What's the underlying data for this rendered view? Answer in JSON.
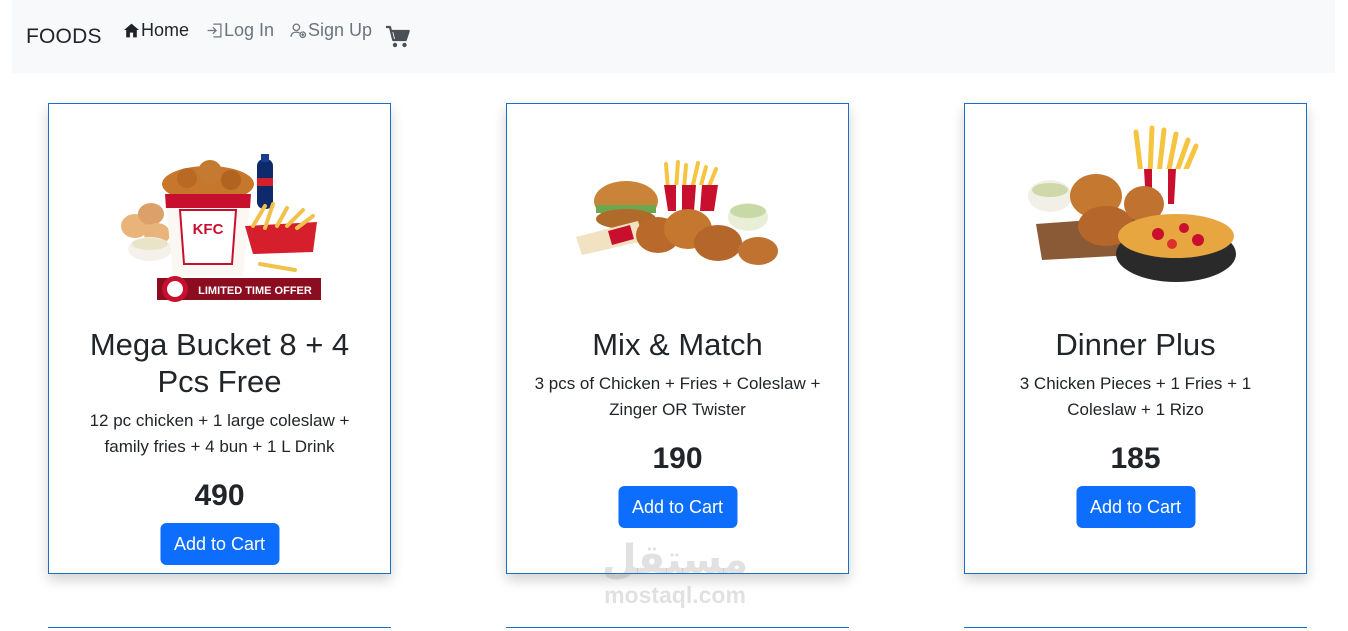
{
  "navbar": {
    "brand": "FOODS",
    "links": [
      {
        "label": "Home",
        "icon": "home-icon",
        "active": true
      },
      {
        "label": "Log In",
        "icon": "login-icon"
      },
      {
        "label": "Sign Up",
        "icon": "user-add-icon"
      }
    ],
    "cart_icon": "cart-icon"
  },
  "products": [
    {
      "title": "Mega Bucket 8 + 4 Pcs Free",
      "description": "12 pc chicken + 1 large coleslaw + family fries + 4 bun + 1 L Drink",
      "price": "490",
      "button": "Add to Cart",
      "badge": "LIMITED TIME OFFER",
      "bucket_text": "KFC"
    },
    {
      "title": "Mix & Match",
      "description": "3 pcs of Chicken + Fries + Coleslaw + Zinger OR Twister",
      "price": "190",
      "button": "Add to Cart"
    },
    {
      "title": "Dinner Plus",
      "description": "3 Chicken Pieces + 1 Fries + 1 Coleslaw + 1 Rizo",
      "price": "185",
      "button": "Add to Cart"
    }
  ],
  "watermark": {
    "arabic": "مستقل",
    "latin": "mostaql.com"
  },
  "colors": {
    "primary": "#0d6efd",
    "card_border": "#1b6fc9",
    "navbar_bg": "#f8f9fa"
  }
}
